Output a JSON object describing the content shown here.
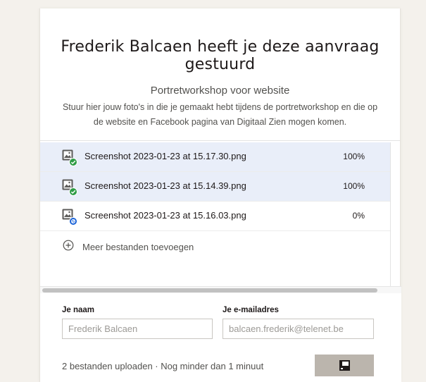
{
  "header": {
    "title": "Frederik Balcaen heeft je deze aanvraag gestuurd",
    "subtitle": "Portretworkshop voor website",
    "description": "Stuur hier jouw foto's in die je gemaakt hebt tijdens de portretworkshop en die op de website en Facebook pagina van Digitaal Zien mogen komen."
  },
  "files": [
    {
      "name": "Screenshot 2023-01-23 at 15.17.30.png",
      "progress": "100%",
      "status": "done",
      "icon": "image-file-icon"
    },
    {
      "name": "Screenshot 2023-01-23 at 15.14.39.png",
      "progress": "100%",
      "status": "done",
      "icon": "image-file-icon"
    },
    {
      "name": "Screenshot 2023-01-23 at 15.16.03.png",
      "progress": "0%",
      "status": "pending",
      "icon": "image-file-icon"
    }
  ],
  "add_more": {
    "label": "Meer bestanden toevoegen",
    "icon": "plus-circle-icon"
  },
  "form": {
    "name_label": "Je naam",
    "name_value": "Frederik Balcaen",
    "email_label": "Je e-mailadres",
    "email_value": "balcaen.frederik@telenet.be"
  },
  "footer": {
    "status": "2 bestanden uploaden · Nog minder dan 1 minuut",
    "button_icon": "loading-spinner-icon"
  },
  "colors": {
    "page_bg": "#f4f1ec",
    "done_row_bg": "#e9eef9",
    "success_badge": "#2f9c46",
    "pending_badge": "#1a63d8",
    "button_bg": "#bbb5ad"
  }
}
